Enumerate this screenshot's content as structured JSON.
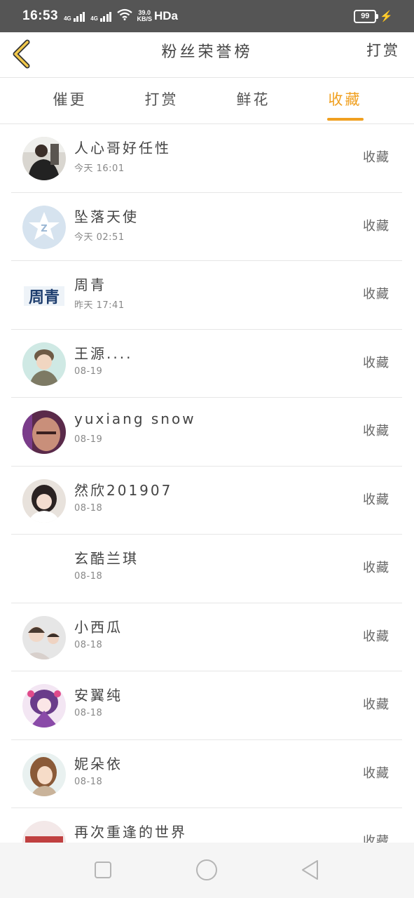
{
  "status_bar": {
    "time": "16:53",
    "net1": "4G",
    "net2": "4G",
    "speed_value": "39.0",
    "speed_unit": "KB/S",
    "hd": "HDa",
    "battery": "99"
  },
  "header": {
    "title": "粉丝荣誉榜",
    "action": "打赏",
    "accent_color": "#f0a020"
  },
  "tabs": [
    {
      "label": "催更",
      "active": false
    },
    {
      "label": "打赏",
      "active": false
    },
    {
      "label": "鲜花",
      "active": false
    },
    {
      "label": "收藏",
      "active": true
    }
  ],
  "list": [
    {
      "name": "人心哥好任性",
      "time": "今天 16:01",
      "action": "收藏",
      "avatar": "photo"
    },
    {
      "name": "坠落天使",
      "time": "今天 02:51",
      "action": "收藏",
      "avatar": "qq-default"
    },
    {
      "name": "周青",
      "time": "昨天 17:41",
      "action": "收藏",
      "avatar": "text-zhouqing"
    },
    {
      "name": "王源....",
      "time": "08-19",
      "action": "收藏",
      "avatar": "photo"
    },
    {
      "name": "yuxiang snow",
      "time": "08-19",
      "action": "收藏",
      "avatar": "photo"
    },
    {
      "name": "然欣201907",
      "time": "08-18",
      "action": "收藏",
      "avatar": "photo"
    },
    {
      "name": "玄酷兰琪",
      "time": "08-18",
      "action": "收藏",
      "avatar": "none"
    },
    {
      "name": "小西瓜",
      "time": "08-18",
      "action": "收藏",
      "avatar": "photo"
    },
    {
      "name": "安翼纯",
      "time": "08-18",
      "action": "收藏",
      "avatar": "anime"
    },
    {
      "name": "妮朵依",
      "time": "08-18",
      "action": "收藏",
      "avatar": "illustration"
    },
    {
      "name": "再次重逢的世界",
      "time": "",
      "action": "收藏",
      "avatar": "photo"
    }
  ],
  "avatar_text": {
    "zhouqing": "周青"
  },
  "navbar": [
    "recent-apps",
    "home",
    "back"
  ]
}
